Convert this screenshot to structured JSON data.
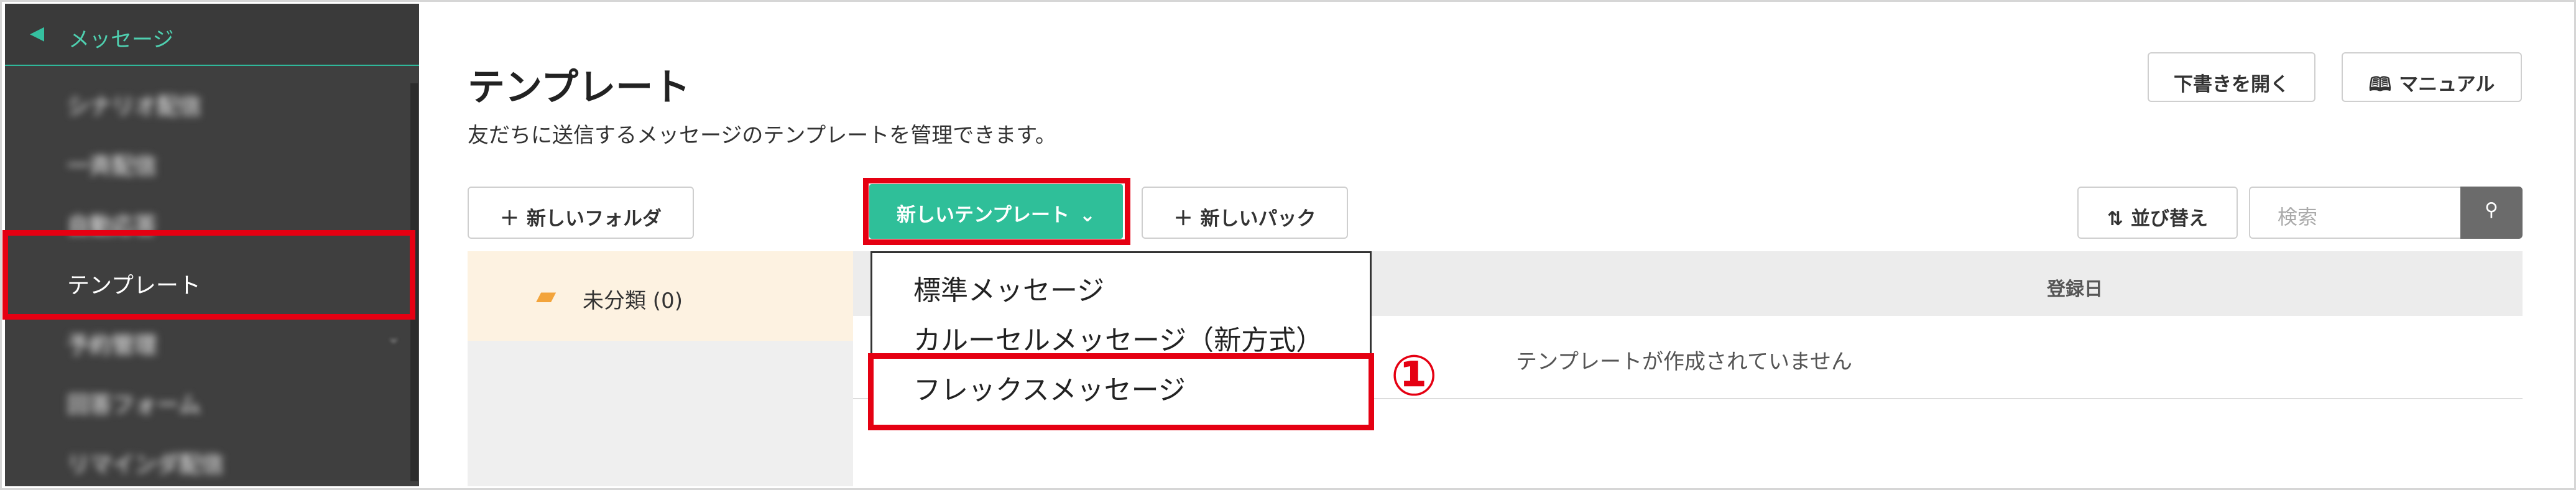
{
  "sidebar": {
    "header": {
      "icon": "megaphone-icon",
      "label": "メッセージ"
    },
    "items": [
      {
        "label": "シナリオ配信"
      },
      {
        "label": "一斉配信"
      },
      {
        "label": "自動応答"
      },
      {
        "label": "テンプレート"
      },
      {
        "label": "予約管理"
      },
      {
        "label": "回答フォーム"
      },
      {
        "label": "リマインダ配信"
      }
    ]
  },
  "page": {
    "title": "テンプレート",
    "description": "友だちに送信するメッセージのテンプレートを管理できます。"
  },
  "toolbar": {
    "open_drafts": "下書きを開く",
    "manual": "マニュアル",
    "new_folder": "新しいフォルダ",
    "new_template": "新しいテンプレート",
    "new_pack": "新しいパック",
    "sort": "並び替え",
    "search_placeholder": "検索"
  },
  "folders": [
    {
      "label": "未分類 (0)"
    }
  ],
  "table": {
    "headers": [
      "登録日"
    ],
    "empty_text": "テンプレートが作成されていません"
  },
  "dropdown": {
    "items": [
      "標準メッセージ",
      "カルーセルメッセージ（新方式）",
      "フレックスメッセージ"
    ]
  },
  "annotation": {
    "callout": "①"
  },
  "colors": {
    "accent": "#2fbf99",
    "highlight": "#e50012",
    "sidebar_bg": "#3f3f3f"
  }
}
